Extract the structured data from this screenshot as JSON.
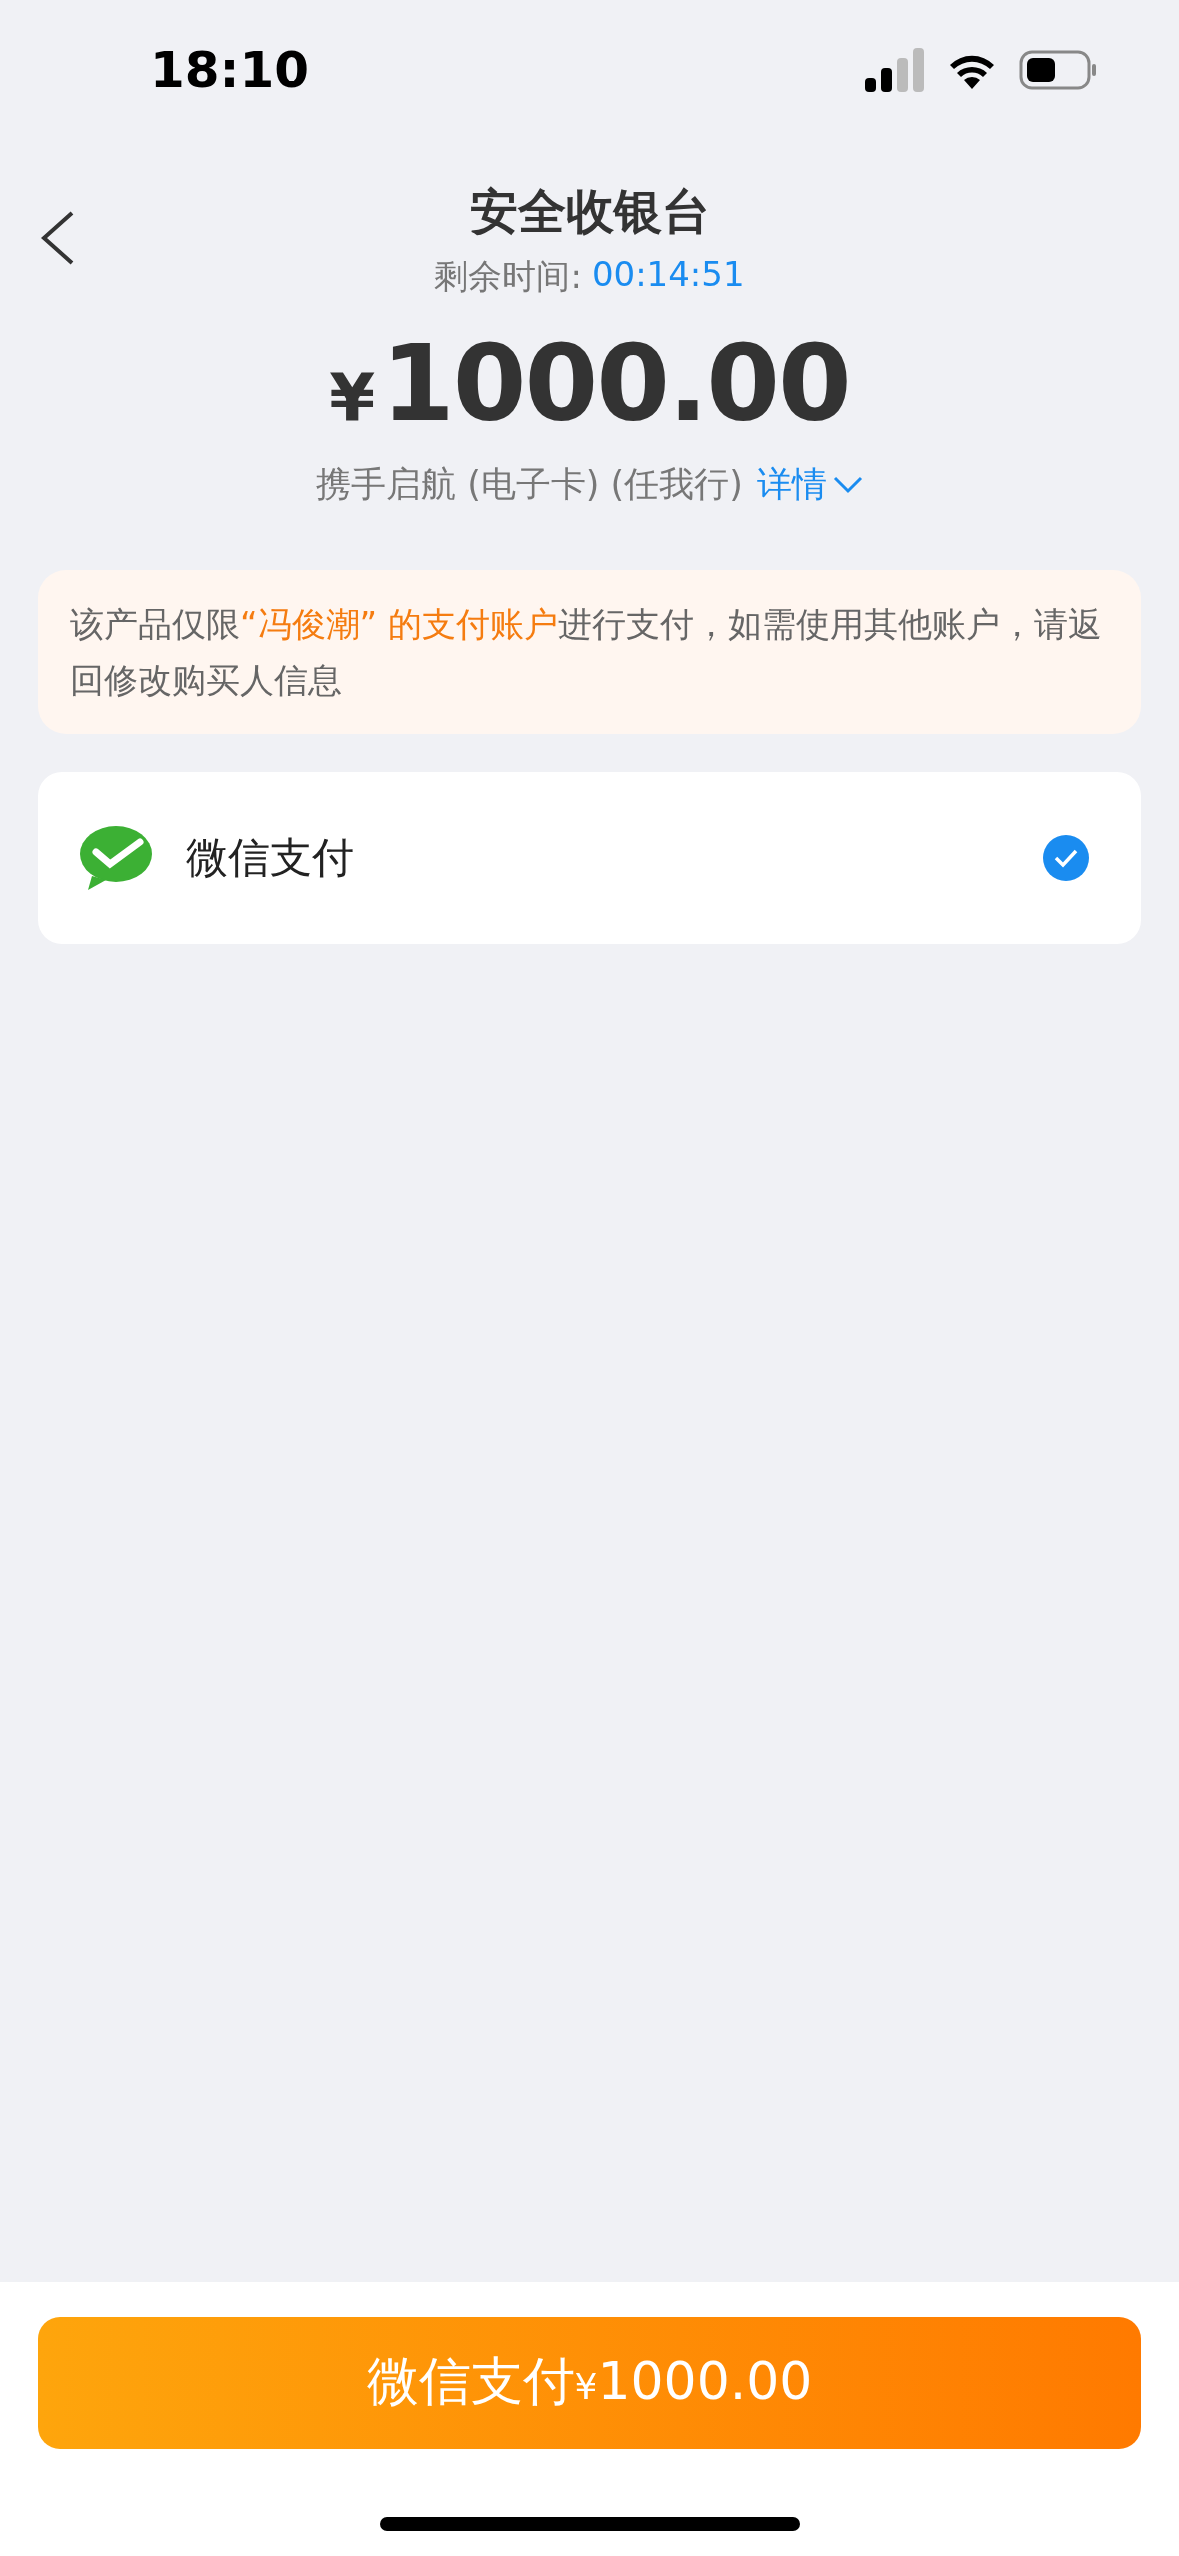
{
  "status_bar": {
    "time": "18:10"
  },
  "header": {
    "title": "安全收银台",
    "countdown_label": "剩余时间:",
    "countdown": "00:14:51"
  },
  "amount": {
    "currency": "¥",
    "value": "1000.00"
  },
  "product": {
    "name": "携手启航 (电子卡) (任我行)",
    "details_link": "详情"
  },
  "notice": {
    "segments": [
      {
        "text": "该产品仅限",
        "highlight": false
      },
      {
        "text": "“冯俊潮” 的支付账户",
        "highlight": true
      },
      {
        "text": "进行支付，如需使用其他账户，请返回修改购买人信息",
        "highlight": false
      }
    ]
  },
  "payment_methods": [
    {
      "label": "微信支付",
      "selected": true
    }
  ],
  "pay_button": {
    "label": "微信支付",
    "currency": "¥",
    "amount": "1000.00"
  }
}
